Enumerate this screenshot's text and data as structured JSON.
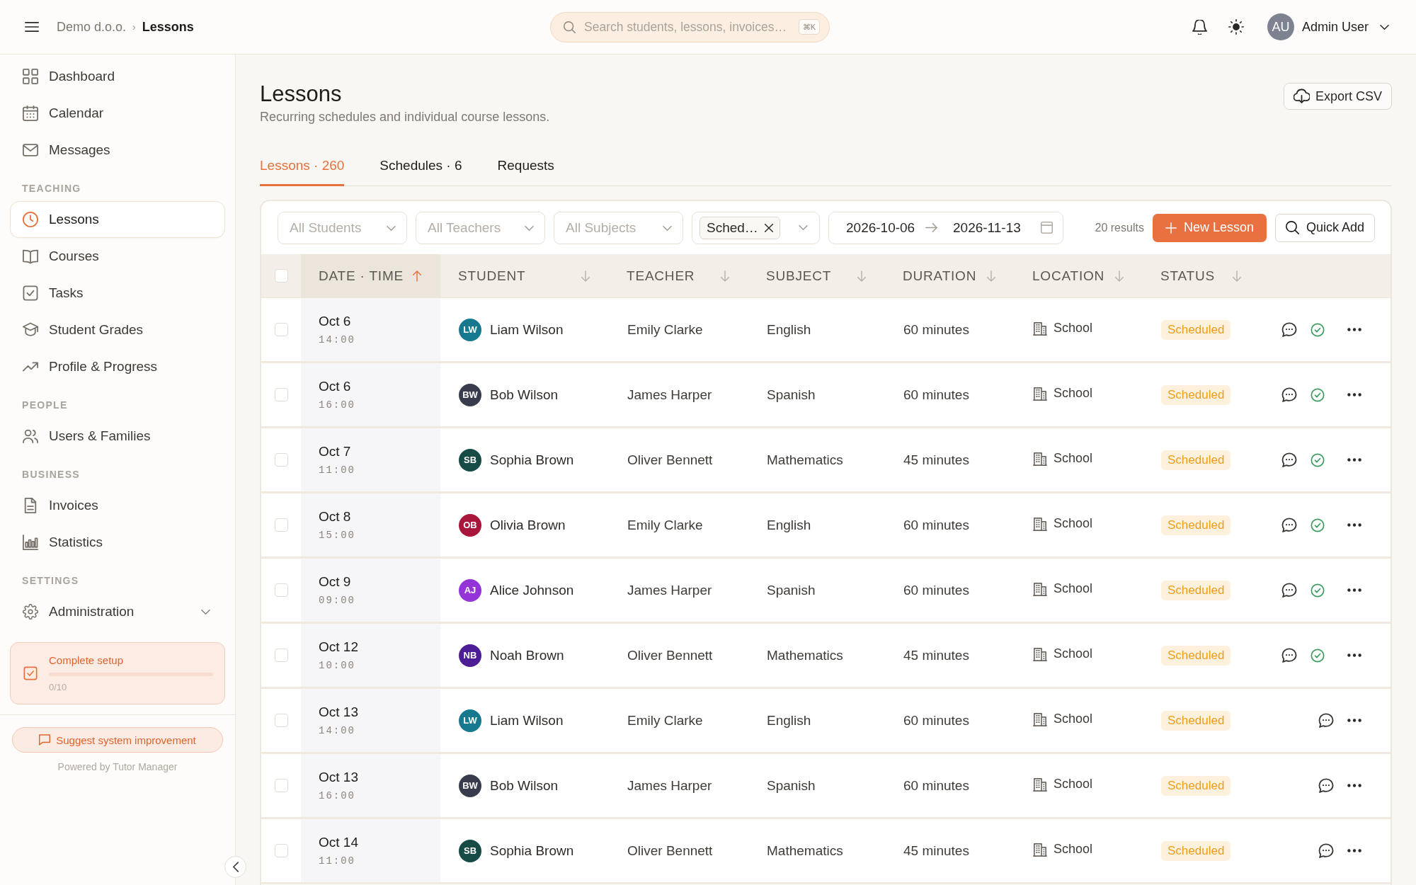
{
  "topbar": {
    "breadcrumb": [
      {
        "label": "Demo d.o.o.",
        "current": false
      },
      {
        "label": "Lessons",
        "current": true
      }
    ],
    "separator": "›",
    "search": {
      "placeholder": "Search students, lessons, invoices…",
      "shortcut": "⌘K"
    },
    "user": {
      "initials": "AU",
      "name": "Admin User"
    }
  },
  "sidebar": {
    "sections": [
      {
        "items": [
          {
            "kind": "dashboard",
            "label": "Dashboard",
            "selected": false
          },
          {
            "kind": "calendar",
            "label": "Calendar",
            "selected": false
          },
          {
            "kind": "messages",
            "label": "Messages",
            "selected": false
          }
        ]
      },
      {
        "title": "TEACHING",
        "items": [
          {
            "kind": "lessons",
            "label": "Lessons",
            "selected": true
          },
          {
            "kind": "courses",
            "label": "Courses",
            "selected": false
          },
          {
            "kind": "tasks",
            "label": "Tasks",
            "selected": false
          },
          {
            "kind": "grades",
            "label": "Student Grades",
            "selected": false
          },
          {
            "kind": "progress",
            "label": "Profile & Progress",
            "selected": false
          }
        ]
      },
      {
        "title": "PEOPLE",
        "items": [
          {
            "kind": "users",
            "label": "Users & Families",
            "selected": false
          }
        ]
      },
      {
        "title": "BUSINESS",
        "items": [
          {
            "kind": "invoices",
            "label": "Invoices",
            "selected": false
          },
          {
            "kind": "statistics",
            "label": "Statistics",
            "selected": false
          }
        ]
      },
      {
        "title": "SETTINGS",
        "items": [
          {
            "kind": "administration",
            "label": "Administration",
            "selected": false,
            "expanded": false
          }
        ]
      }
    ],
    "setup": {
      "title": "Complete setup",
      "progress": "0/10"
    },
    "suggest_button": "Suggest system improvement",
    "footer": "Powered by Tutor Manager"
  },
  "page": {
    "title": "Lessons",
    "subtitle": "Recurring schedules and individual course lessons.",
    "export_button": "Export CSV"
  },
  "tabs": [
    {
      "label": "Lessons · 260",
      "selected": true
    },
    {
      "label": "Schedules · 6",
      "selected": false
    },
    {
      "label": "Requests",
      "selected": false
    }
  ],
  "filters": {
    "selects": [
      {
        "placeholder": "All Students"
      },
      {
        "placeholder": "All Teachers"
      },
      {
        "placeholder": "All Subjects"
      }
    ],
    "status": {
      "chips": [
        "Sched…"
      ]
    },
    "date_range": {
      "start": "2026-10-06",
      "end": "2026-11-13"
    },
    "results": "20 results",
    "new_button": "New Lesson",
    "quick_add_button": "Quick Add"
  },
  "table": {
    "select_all": {
      "checked": false
    },
    "columns": [
      {
        "label": "DATE · TIME",
        "sorted": true
      },
      {
        "label": "STUDENT",
        "sorted": false
      },
      {
        "label": "TEACHER",
        "sorted": false
      },
      {
        "label": "SUBJECT",
        "sorted": false
      },
      {
        "label": "DURATION",
        "sorted": false
      },
      {
        "label": "LOCATION",
        "sorted": false
      },
      {
        "label": "STATUS",
        "sorted": false
      }
    ],
    "rows": [
      {
        "checked": false,
        "date": "Oct 6",
        "time": "14:00",
        "student": {
          "initials": "LW",
          "name": "Liam Wilson",
          "color": "#17798f"
        },
        "teacher": "Emily Clarke",
        "subject": "English",
        "duration": "60 minutes",
        "location": "School",
        "status": "Scheduled",
        "confirmable": true
      },
      {
        "checked": false,
        "date": "Oct 6",
        "time": "16:00",
        "student": {
          "initials": "BW",
          "name": "Bob Wilson",
          "color": "#383c4c"
        },
        "teacher": "James Harper",
        "subject": "Spanish",
        "duration": "60 minutes",
        "location": "School",
        "status": "Scheduled",
        "confirmable": true
      },
      {
        "checked": false,
        "date": "Oct 7",
        "time": "11:00",
        "student": {
          "initials": "SB",
          "name": "Sophia Brown",
          "color": "#174b45"
        },
        "teacher": "Oliver Bennett",
        "subject": "Mathematics",
        "duration": "45 minutes",
        "location": "School",
        "status": "Scheduled",
        "confirmable": true
      },
      {
        "checked": false,
        "date": "Oct 8",
        "time": "15:00",
        "student": {
          "initials": "OB",
          "name": "Olivia Brown",
          "color": "#a8173b"
        },
        "teacher": "Emily Clarke",
        "subject": "English",
        "duration": "60 minutes",
        "location": "School",
        "status": "Scheduled",
        "confirmable": true
      },
      {
        "checked": false,
        "date": "Oct 9",
        "time": "09:00",
        "student": {
          "initials": "AJ",
          "name": "Alice Johnson",
          "color": "#9333d9"
        },
        "teacher": "James Harper",
        "subject": "Spanish",
        "duration": "60 minutes",
        "location": "School",
        "status": "Scheduled",
        "confirmable": true
      },
      {
        "checked": false,
        "date": "Oct 12",
        "time": "10:00",
        "student": {
          "initials": "NB",
          "name": "Noah Brown",
          "color": "#4c1d95"
        },
        "teacher": "Oliver Bennett",
        "subject": "Mathematics",
        "duration": "45 minutes",
        "location": "School",
        "status": "Scheduled",
        "confirmable": true
      },
      {
        "checked": false,
        "date": "Oct 13",
        "time": "14:00",
        "student": {
          "initials": "LW",
          "name": "Liam Wilson",
          "color": "#17798f"
        },
        "teacher": "Emily Clarke",
        "subject": "English",
        "duration": "60 minutes",
        "location": "School",
        "status": "Scheduled",
        "confirmable": false
      },
      {
        "checked": false,
        "date": "Oct 13",
        "time": "16:00",
        "student": {
          "initials": "BW",
          "name": "Bob Wilson",
          "color": "#383c4c"
        },
        "teacher": "James Harper",
        "subject": "Spanish",
        "duration": "60 minutes",
        "location": "School",
        "status": "Scheduled",
        "confirmable": false
      },
      {
        "checked": false,
        "date": "Oct 14",
        "time": "11:00",
        "student": {
          "initials": "SB",
          "name": "Sophia Brown",
          "color": "#174b45"
        },
        "teacher": "Oliver Bennett",
        "subject": "Mathematics",
        "duration": "45 minutes",
        "location": "School",
        "status": "Scheduled",
        "confirmable": false
      }
    ]
  }
}
